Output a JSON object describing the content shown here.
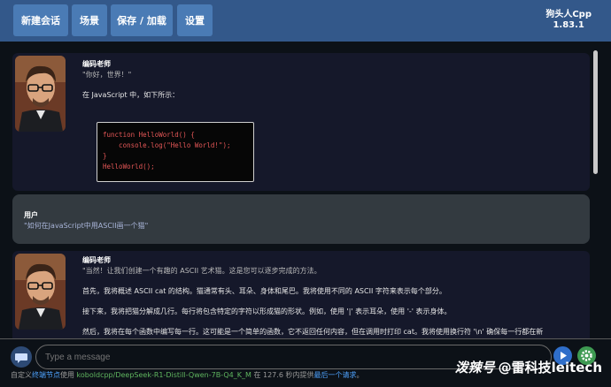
{
  "nav": {
    "new_chat": "新建会话",
    "scenarios": "场景",
    "save_load": "保存 / 加载",
    "settings": "设置"
  },
  "brand": {
    "title": "狗头人Cpp",
    "version": "1.83.1"
  },
  "messages": {
    "m1": {
      "speaker": "编码老师",
      "quote": "\"你好，世界！\"",
      "text": "在 JavaScript 中，如下所示：",
      "code": [
        "function HelloWorld() {",
        "    console.log(\"Hello World!\");",
        "}",
        "HelloWorld();"
      ]
    },
    "m2": {
      "speaker": "用户",
      "quote": "\"如何在JavaScript中用ASCII画一个猫\""
    },
    "m3": {
      "speaker": "编码老师",
      "quote": "\"当然！让我们创建一个有趣的 ASCII 艺术猫。这是您可以逐步完成的方法。",
      "p1": "首先，我将概述 ASCII cat 的结构。猫通常有头、耳朵、身体和尾巴。我将使用不同的 ASCII 字符来表示每个部分。",
      "p2": "接下来，我将把猫分解成几行。每行将包含特定的字符以形成猫的形状。例如，使用 '|' 表示耳朵，使用 '-' 表示身体。",
      "p3": "然后，我将在每个函数中编写每一行。这可能是一个简单的函数，它不返回任何内容，但在调用时打印 cat。我将使用换行符 '\\n' 确保每一行都在新"
    }
  },
  "input": {
    "placeholder": "Type a message"
  },
  "footer": {
    "prefix": "自定义",
    "link1": "终端节点",
    "mid1": "使用 ",
    "model": "koboldcpp/DeepSeek-R1-Distill-Qwen-7B-Q4_K_M",
    "mid2": " 在 127.6 秒内提供",
    "link2": "最后一个请求",
    "suffix": "。"
  },
  "watermark": "@雷科技leitech",
  "watermark_logo": "泼辣号",
  "icons": {
    "chat": "chat-bubble-icon",
    "send": "send-icon",
    "settings": "gear-icon"
  }
}
